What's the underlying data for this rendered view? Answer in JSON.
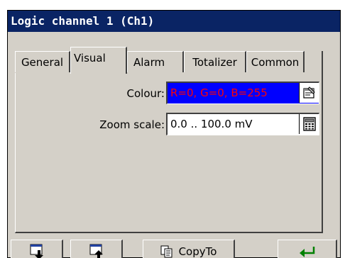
{
  "window": {
    "title": "Logic channel 1 (Ch1)"
  },
  "tabs": [
    {
      "label": "General",
      "active": false
    },
    {
      "label": "Visual",
      "active": true
    },
    {
      "label": "Alarm",
      "active": false
    },
    {
      "label": "Totalizer",
      "active": false
    },
    {
      "label": "Common",
      "active": false
    }
  ],
  "fields": {
    "colour": {
      "label": "Colour:",
      "value": "R=0, G=0, B=255",
      "bg": "#0000ff",
      "fg": "#ff0000"
    },
    "zoom_scale": {
      "label": "Zoom scale:",
      "value": "0.0 .. 100.0 mV"
    }
  },
  "buttons": {
    "download_icon": "download-icon",
    "upload_icon": "upload-icon",
    "copyto": {
      "label": "CopyTo",
      "icon": "copy-icon"
    },
    "enter_icon": "enter-arrow-icon"
  },
  "colors": {
    "title_bg": "#0a2464",
    "enter_arrow": "#008000"
  }
}
